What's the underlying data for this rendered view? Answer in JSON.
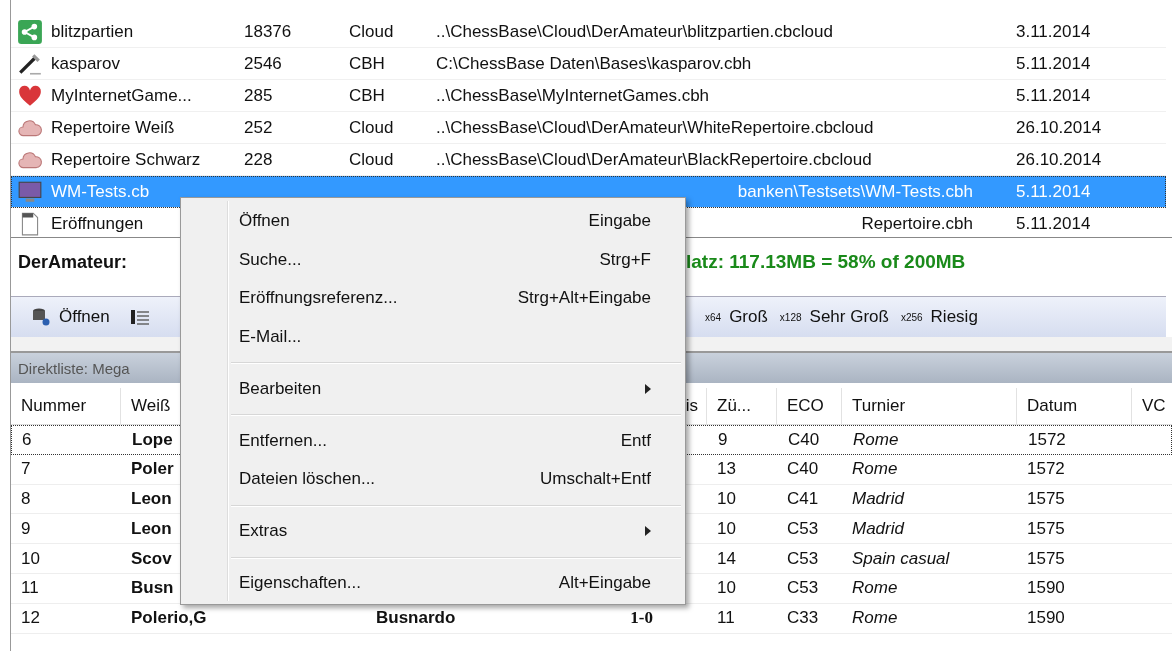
{
  "databases": [
    {
      "kind": "shared",
      "name": "blitzpartien",
      "games": "18376",
      "type": "Cloud",
      "path": "..\\ChessBase\\Cloud\\DerAmateur\\blitzpartien.cbcloud",
      "date": "3.11.2014",
      "selected": false
    },
    {
      "kind": "tool",
      "name": "kasparov",
      "games": "2546",
      "type": "CBH",
      "path": "C:\\ChessBase Daten\\Bases\\kasparov.cbh",
      "date": "5.11.2014",
      "selected": false
    },
    {
      "kind": "favorite",
      "name": "MyInternetGame...",
      "games": "285",
      "type": "CBH",
      "path": "..\\ChessBase\\MyInternetGames.cbh",
      "date": "5.11.2014",
      "selected": false
    },
    {
      "kind": "cloud",
      "name": "Repertoire Weiß",
      "games": "252",
      "type": "Cloud",
      "path": "..\\ChessBase\\Cloud\\DerAmateur\\WhiteRepertoire.cbcloud",
      "date": "26.10.2014",
      "selected": false
    },
    {
      "kind": "cloud",
      "name": "Repertoire Schwarz",
      "games": "228",
      "type": "Cloud",
      "path": "..\\ChessBase\\Cloud\\DerAmateur\\BlackRepertoire.cbcloud",
      "date": "26.10.2014",
      "selected": false
    },
    {
      "kind": "monitor",
      "name": "WM-Tests.cb",
      "path_end": "banken\\Testsets\\WM-Tests.cbh",
      "date": "5.11.2014",
      "selected": true
    },
    {
      "kind": "file",
      "name": "Eröffnungen",
      "path_end": "Repertoire.cbh",
      "date": "5.11.2014",
      "selected": false
    }
  ],
  "status": {
    "label": "DerAmateur:",
    "space": "latz: 117.13MB = 58% of 200MB"
  },
  "toolbar": [
    {
      "kind": "open",
      "label": "Öffnen"
    },
    {
      "kind": "list"
    },
    {
      "kind": "size",
      "badge": "x64",
      "label": "Groß"
    },
    {
      "kind": "size",
      "badge": "x128",
      "label": "Sehr Groß"
    },
    {
      "kind": "size",
      "badge": "x256",
      "label": "Riesig"
    }
  ],
  "list_title": "Direktliste: Mega",
  "games": {
    "columns": [
      "Nummer",
      "Weiß",
      "",
      "is",
      "Zü...",
      "ECO",
      "Turnier",
      "Datum",
      "VC"
    ],
    "rows": [
      {
        "no": "6",
        "white": "Lope",
        "moves": "9",
        "eco": "C40",
        "event": "Rome",
        "date": "1572",
        "focused": true
      },
      {
        "no": "7",
        "white": "Poler",
        "moves": "13",
        "eco": "C40",
        "event": "Rome",
        "date": "1572",
        "focused": false
      },
      {
        "no": "8",
        "white": "Leon",
        "moves": "10",
        "eco": "C41",
        "event": "Madrid",
        "date": "1575",
        "focused": false
      },
      {
        "no": "9",
        "white": "Leon",
        "moves": "10",
        "eco": "C53",
        "event": "Madrid",
        "date": "1575",
        "focused": false
      },
      {
        "no": "10",
        "white": "Scov",
        "moves": "14",
        "eco": "C53",
        "event": "Spain casual",
        "date": "1575",
        "focused": false
      },
      {
        "no": "11",
        "white": "Busn",
        "moves": "10",
        "eco": "C53",
        "event": "Rome",
        "date": "1590",
        "focused": false
      },
      {
        "no": "12",
        "white": "Polerio,G",
        "black": "Busnardo",
        "result": "1-0",
        "moves": "11",
        "eco": "C33",
        "event": "Rome",
        "date": "1590",
        "focused": false
      }
    ]
  },
  "context_menu": [
    {
      "kind": "item",
      "label": "Öffnen",
      "shortcut": "Eingabe"
    },
    {
      "kind": "item",
      "label": "Suche...",
      "shortcut": "Strg+F"
    },
    {
      "kind": "item",
      "label": "Eröffnungsreferenz...",
      "shortcut": "Strg+Alt+Eingabe"
    },
    {
      "kind": "item",
      "label": "E-Mail..."
    },
    {
      "kind": "separator"
    },
    {
      "kind": "submenu",
      "label": "Bearbeiten"
    },
    {
      "kind": "separator"
    },
    {
      "kind": "item",
      "label": "Entfernen...",
      "shortcut": "Entf"
    },
    {
      "kind": "item",
      "label": "Dateien löschen...",
      "shortcut": "Umschalt+Entf"
    },
    {
      "kind": "separator"
    },
    {
      "kind": "submenu",
      "label": "Extras"
    },
    {
      "kind": "separator"
    },
    {
      "kind": "item",
      "label": "Eigenschaften...",
      "shortcut": "Alt+Eingabe"
    }
  ]
}
